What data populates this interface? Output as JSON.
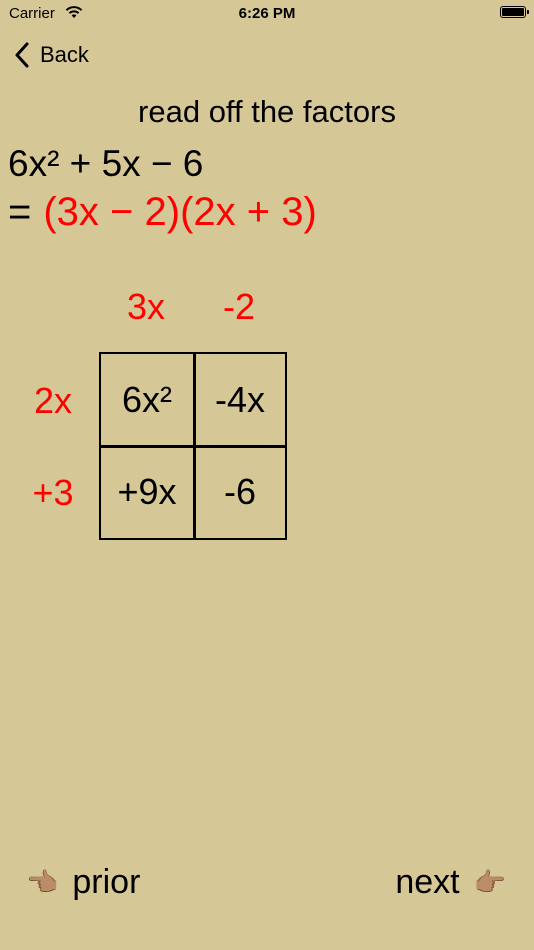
{
  "status_bar": {
    "carrier": "Carrier",
    "time": "6:26 PM"
  },
  "nav": {
    "back_label": "Back"
  },
  "heading": "read off the factors",
  "expression": "6x² + 5x − 6",
  "equals_sign": "=",
  "factored": "(3x − 2)(2x + 3)",
  "box": {
    "column_factors": [
      "3x",
      "-2"
    ],
    "row_factors": [
      "2x",
      "+3"
    ],
    "cells": [
      [
        "6x²",
        "-4x"
      ],
      [
        "+9x",
        "-6"
      ]
    ]
  },
  "footer": {
    "prior_label": "prior",
    "next_label": "next",
    "prior_hand": "👈🏽",
    "next_hand": "👉🏽"
  },
  "colors": {
    "background": "#d6c896",
    "accent": "#ff0000"
  }
}
